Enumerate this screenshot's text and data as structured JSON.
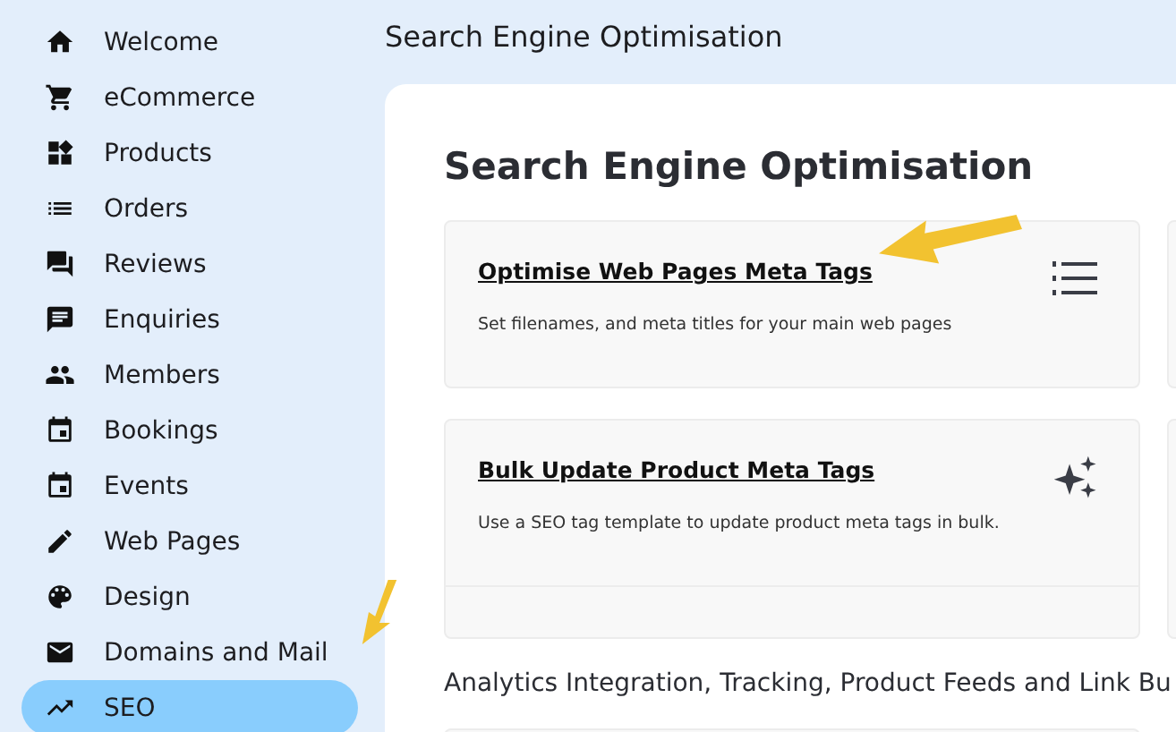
{
  "sidebar": {
    "items": [
      {
        "label": "Welcome",
        "selected": false
      },
      {
        "label": "eCommerce",
        "selected": false
      },
      {
        "label": "Products",
        "selected": false
      },
      {
        "label": "Orders",
        "selected": false
      },
      {
        "label": "Reviews",
        "selected": false
      },
      {
        "label": "Enquiries",
        "selected": false
      },
      {
        "label": "Members",
        "selected": false
      },
      {
        "label": "Bookings",
        "selected": false
      },
      {
        "label": "Events",
        "selected": false
      },
      {
        "label": "Web Pages",
        "selected": false
      },
      {
        "label": "Design",
        "selected": false
      },
      {
        "label": "Domains and Mail",
        "selected": false
      },
      {
        "label": "SEO",
        "selected": true
      }
    ]
  },
  "header": {
    "title": "Search Engine Optimisation"
  },
  "page": {
    "title": "Search Engine Optimisation",
    "cards": [
      {
        "title": "Optimise Web Pages Meta Tags",
        "description": "Set filenames, and meta titles for your main web pages"
      },
      {
        "title": "Bulk Update Product Meta Tags",
        "description": "Use a SEO tag template to update product meta tags in bulk."
      }
    ],
    "section_title": "Analytics Integration, Tracking, Product Feeds and Link Bu"
  }
}
